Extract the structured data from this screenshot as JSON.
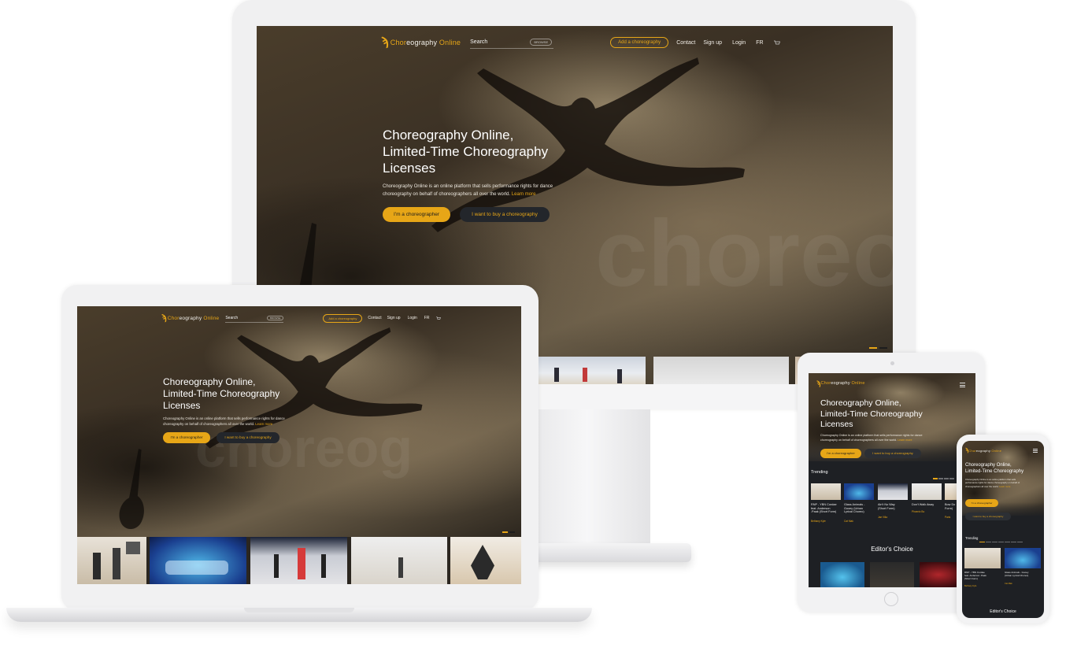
{
  "brand": {
    "logo_text_a": "Chor",
    "logo_text_b": "eography",
    "logo_text_c": " Online",
    "accent": "#e7a617",
    "dark": "#1e2024"
  },
  "nav": {
    "search_label": "Search",
    "browse_label": "BROWSE",
    "add_label": "Add a choreography",
    "contact": "Contact",
    "signup": "Sign up",
    "login": "Login",
    "lang": "FR",
    "cart_icon": "cart-icon",
    "menu_icon": "hamburger-icon"
  },
  "hero": {
    "title_1": "Choreography Online,",
    "title_2": "Limited-Time Choreography",
    "title_3": "Licenses",
    "desc_1": "Choreography Online is an online platform that sells performance rights for dance",
    "desc_2": "choreography on behalf of choreographers all over the world.",
    "learn_more": "Learn more",
    "btn_choreographer": "I'm a choreographer",
    "btn_buy": "I want to buy a choreography",
    "watermark": "choreog"
  },
  "tablet": {
    "desc_1": "Choreography Online is an online platform that sells performance rights for dance",
    "desc_2": "choreography on behalf of choreographers all over the world.",
    "trending": "Trending",
    "editors_choice": "Editor's Choice",
    "cards": [
      {
        "title_1": "RNP - YBN Cordae",
        "title_2": "feat. Anderson",
        "title_3": ".Paak (Short Form)",
        "author": "Bethany Kyle",
        "badge": ""
      },
      {
        "title_1": "Glass Animals -",
        "title_2": "Gooey (Urban",
        "title_3": "Lyrical Choreo)",
        "author": "Cat Mak",
        "badge": ""
      },
      {
        "title_1": "Ain't No Way",
        "title_2": "(Short Form)",
        "title_3": "",
        "author": "Jae Villa",
        "badge": ""
      },
      {
        "title_1": "Don't Walk Away",
        "title_2": "",
        "title_3": "",
        "author": "Phoenix Bo",
        "badge": ""
      },
      {
        "title_1": "Bow Do",
        "title_2": "Form)",
        "title_3": "",
        "author": "Paris",
        "badge": ""
      }
    ]
  },
  "phone": {
    "desc_1": "Choreography Online is an online platform that sells",
    "desc_2": "performance rights for dance choreography on behalf of",
    "desc_3": "choreographers all over the world.",
    "learn_more": "Learn more",
    "trending": "Trending",
    "editors_choice": "Editor's Choice",
    "cards": [
      {
        "title_1": "RNP - YBN Cordae",
        "title_2": "feat. Anderson .Paak",
        "title_3": "(Short Form)",
        "author": "Bethany Kyle"
      },
      {
        "title_1": "Glass Animals - Gooey",
        "title_2": "(Urban Lyrical Choreo)",
        "title_3": "",
        "author": "Cat Mak"
      }
    ]
  }
}
